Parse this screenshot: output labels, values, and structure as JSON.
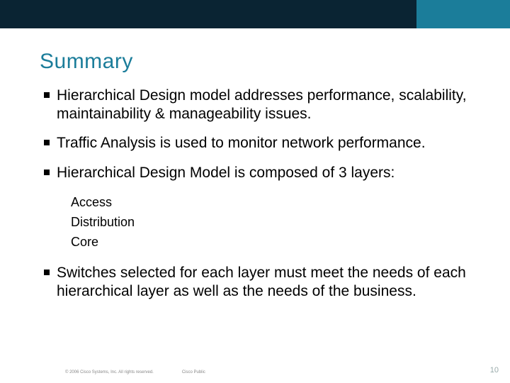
{
  "title": "Summary",
  "bullets": {
    "b0": "Hierarchical Design model addresses performance, scalability, maintainability & manageability issues.",
    "b1": "Traffic Analysis is used to monitor network performance.",
    "b2": "Hierarchical Design Model is composed of 3 layers:",
    "b3": "Switches selected for each layer must meet the needs of each hierarchical layer as well as the needs of the business."
  },
  "sublayers": {
    "s0": "Access",
    "s1": "Distribution",
    "s2": "Core"
  },
  "footer": {
    "copyright": "© 2006 Cisco Systems, Inc. All rights reserved.",
    "classification": "Cisco Public",
    "page": "10"
  }
}
